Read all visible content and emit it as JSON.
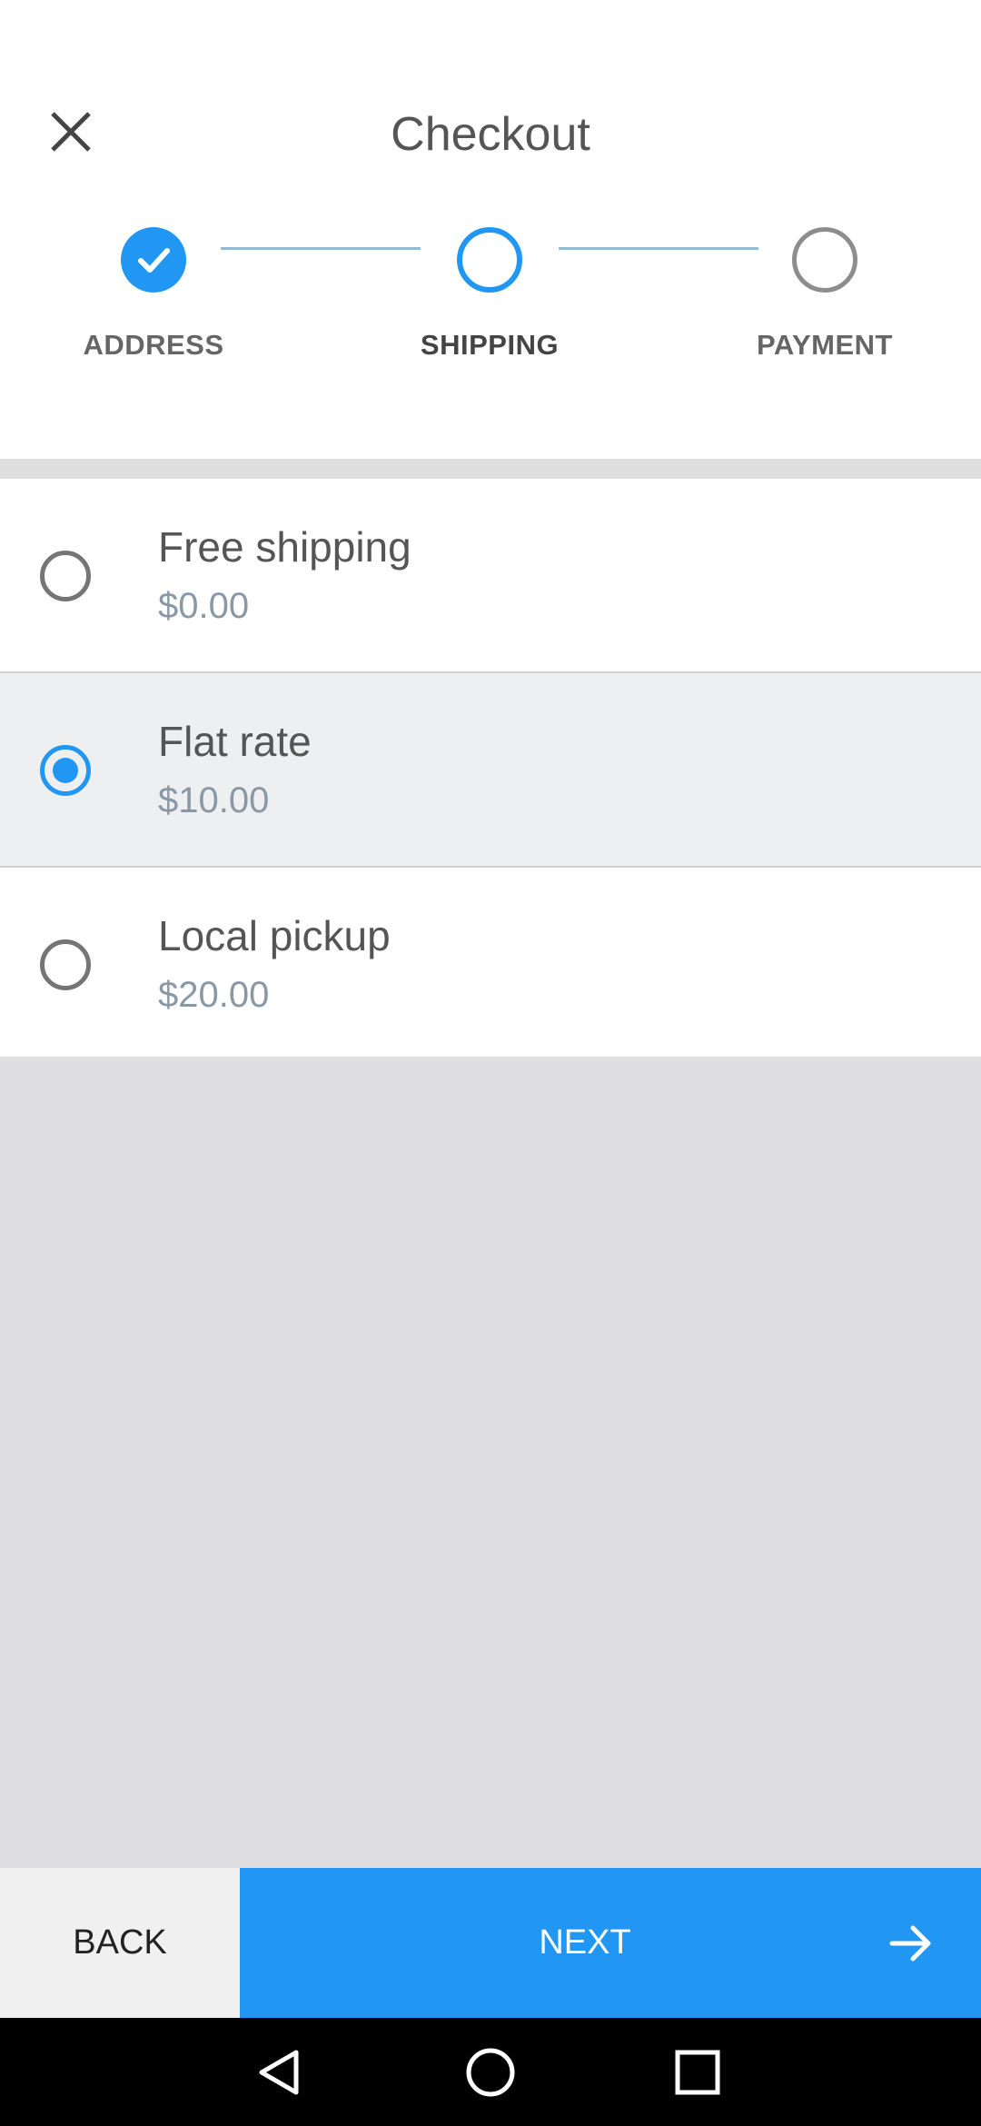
{
  "header": {
    "title": "Checkout",
    "close_icon": "close-icon"
  },
  "stepper": {
    "steps": [
      {
        "label": "ADDRESS",
        "state": "completed",
        "icon": "check-icon"
      },
      {
        "label": "SHIPPING",
        "state": "active"
      },
      {
        "label": "PAYMENT",
        "state": "pending"
      }
    ]
  },
  "shipping_options": [
    {
      "name": "Free shipping",
      "price": "$0.00",
      "selected": false
    },
    {
      "name": "Flat rate",
      "price": "$10.00",
      "selected": true
    },
    {
      "name": "Local pickup",
      "price": "$20.00",
      "selected": false
    }
  ],
  "footer": {
    "back_label": "BACK",
    "next_label": "NEXT",
    "next_icon": "arrow-right-icon"
  },
  "system_nav": {
    "back_icon": "nav-back-icon",
    "home_icon": "nav-home-icon",
    "recents_icon": "nav-recents-icon"
  },
  "colors": {
    "accent": "#2196f3",
    "text_primary": "#555555",
    "text_price": "#8a98a6",
    "selected_row_bg": "#eeeff1",
    "empty_area_bg": "#dfdee0"
  }
}
